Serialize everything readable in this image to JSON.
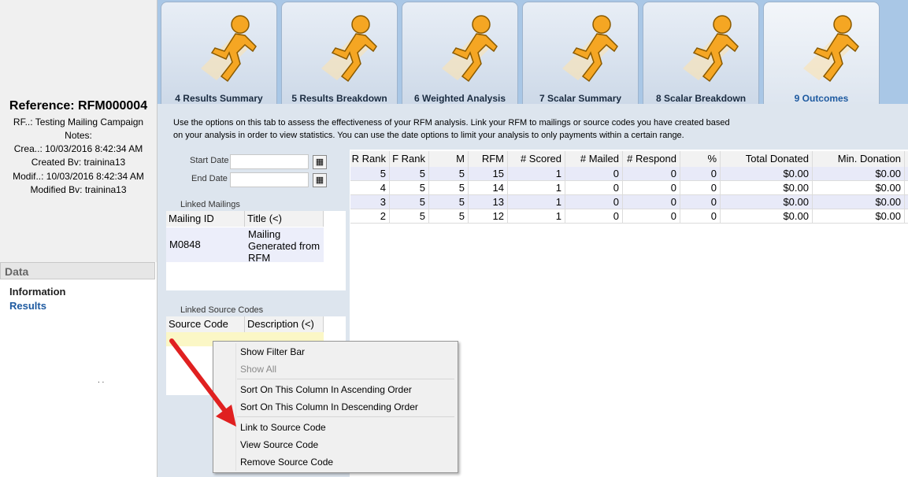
{
  "reference": {
    "title": "Reference: RFM000004",
    "rfm_line": "RF..: Testing Mailing Campaign",
    "notes": "Notes:",
    "created_line": "Crea..: 10/03/2016 8:42:34 AM",
    "created_by": "Created Bv: trainina13",
    "modified_line": "Modif..: 10/03/2016 8:42:34 AM",
    "modified_by": "Modified Bv: trainina13"
  },
  "sidebar": {
    "section": "Data",
    "items": [
      {
        "label": "Information"
      },
      {
        "label": "Results"
      }
    ],
    "dots": ". ."
  },
  "tabs": [
    {
      "label": "4 Results Summary"
    },
    {
      "label": "5 Results Breakdown"
    },
    {
      "label": "6 Weighted Analysis"
    },
    {
      "label": "7 Scalar Summary"
    },
    {
      "label": "8 Scalar Breakdown"
    },
    {
      "label": "9 Outcomes"
    }
  ],
  "description": "Use the options on this tab to assess the effectiveness of your RFM analysis. Link your RFM to mailings or source codes you have created based on your analysis in order to view statistics. You can use the date options to limit your analysis to only payments within a certain range.",
  "dates": {
    "start_label": "Start Date",
    "end_label": "End Date",
    "start_value": "",
    "end_value": ""
  },
  "linked_mailings": {
    "title": "Linked Mailings",
    "columns": [
      "Mailing ID",
      "Title (<)"
    ],
    "rows": [
      [
        "M0848",
        "Mailing Generated from RFM"
      ]
    ]
  },
  "linked_source_codes": {
    "title": "Linked Source Codes",
    "columns": [
      "Source Code",
      "Description (<)"
    ]
  },
  "results": {
    "columns": [
      "R Rank",
      "F Rank",
      "M",
      "RFM",
      "# Scored",
      "# Mailed",
      "# Respond",
      "%",
      "Total Donated",
      "Min. Donation"
    ],
    "rows": [
      [
        "5",
        "5",
        "5",
        "15",
        "1",
        "0",
        "0",
        "0",
        "$0.00",
        "$0.00"
      ],
      [
        "4",
        "5",
        "5",
        "14",
        "1",
        "0",
        "0",
        "0",
        "$0.00",
        "$0.00"
      ],
      [
        "3",
        "5",
        "5",
        "13",
        "1",
        "0",
        "0",
        "0",
        "$0.00",
        "$0.00"
      ],
      [
        "2",
        "5",
        "5",
        "12",
        "1",
        "0",
        "0",
        "0",
        "$0.00",
        "$0.00"
      ]
    ]
  },
  "context_menu": {
    "items": [
      {
        "label": "Show Filter Bar",
        "enabled": true
      },
      {
        "label": "Show All",
        "enabled": false
      },
      {
        "label": "Sort On This Column In Ascending Order",
        "enabled": true
      },
      {
        "label": "Sort On This Column In Descending Order",
        "enabled": true
      },
      {
        "label": "Link to Source Code",
        "enabled": true
      },
      {
        "label": "View Source Code",
        "enabled": true
      },
      {
        "label": "Remove Source Code",
        "enabled": true
      }
    ]
  },
  "colors": {
    "accent": "#1e5aa0",
    "tabstrip": "#a9c7e6",
    "runner": "#f5a623",
    "annotation_arrow": "#e02020"
  }
}
